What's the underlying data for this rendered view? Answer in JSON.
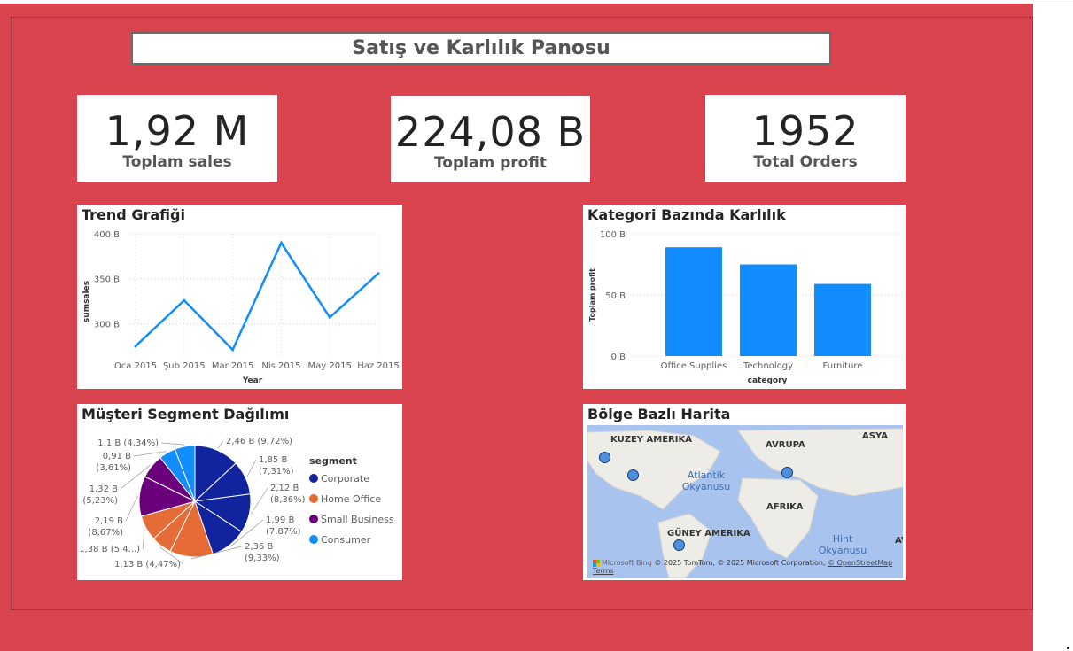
{
  "dashboard": {
    "title": "Satış ve Karlılık Panosu",
    "kpis": [
      {
        "value": "1,92 M",
        "label": "Toplam sales"
      },
      {
        "value": "224,08 B",
        "label": "Toplam profit"
      },
      {
        "value": "1952",
        "label": "Total Orders"
      }
    ]
  },
  "colors": {
    "background": "#d9444f",
    "accent": "#118dff",
    "corporate": "#12239e",
    "home_office": "#e66c37",
    "small_business": "#6b007b",
    "consumer": "#118dff"
  },
  "chart_data": [
    {
      "type": "line",
      "title": "Trend Grafiği",
      "xlabel": "Year",
      "ylabel": "sumsales",
      "x": [
        "Oca 2015",
        "Şub 2015",
        "Mar 2015",
        "Nis 2015",
        "May 2015",
        "Haz 2015"
      ],
      "series": [
        {
          "values": [
            275,
            326,
            271,
            390,
            307,
            356
          ]
        }
      ],
      "ylim": [
        265,
        400
      ],
      "yticks": [
        {
          "value": 300,
          "label": "300 B"
        },
        {
          "value": 350,
          "label": "350 B"
        },
        {
          "value": 400,
          "label": "400 B"
        }
      ],
      "grid": true
    },
    {
      "type": "bar",
      "title": "Kategori Bazında Karlılık",
      "xlabel": "category",
      "ylabel": "Toplam profit",
      "categories": [
        "Office Supplies",
        "Technology",
        "Furniture"
      ],
      "values": [
        89,
        75,
        59
      ],
      "ylim": [
        0,
        100
      ],
      "yticks": [
        {
          "value": 0,
          "label": "0 B"
        },
        {
          "value": 50,
          "label": "50 B"
        },
        {
          "value": 100,
          "label": "100 B"
        }
      ],
      "grid": true
    },
    {
      "type": "pie",
      "title": "Müşteri Segment Dağılımı",
      "legend_title": "segment",
      "legend": [
        {
          "name": "Corporate",
          "color": "#12239e"
        },
        {
          "name": "Home Office",
          "color": "#e66c37"
        },
        {
          "name": "Small Business",
          "color": "#6b007b"
        },
        {
          "name": "Consumer",
          "color": "#118dff"
        }
      ],
      "slices": [
        {
          "segment": "Corporate",
          "value": 2.46,
          "pct": 9.72,
          "label": [
            "2,46 B (9,72%)"
          ]
        },
        {
          "segment": "Corporate",
          "value": 1.85,
          "pct": 7.31,
          "label": [
            "1,85 B",
            "(7,31%)"
          ]
        },
        {
          "segment": "Corporate",
          "value": 2.12,
          "pct": 8.36,
          "label": [
            "2,12 B",
            "(8,36%)"
          ]
        },
        {
          "segment": "Corporate",
          "value": 1.99,
          "pct": 7.87,
          "label": [
            "1,99 B",
            "(7,87%)"
          ]
        },
        {
          "segment": "Home Office",
          "value": 2.36,
          "pct": 9.33,
          "label": [
            "2,36 B",
            "(9,33%)"
          ]
        },
        {
          "segment": "Home Office",
          "value": 1.13,
          "pct": 4.47,
          "label": [
            "1,13 B (4,47%)"
          ]
        },
        {
          "segment": "Home Office",
          "value": 1.38,
          "pct": 5.45,
          "label": [
            "1,38 B (5,4...)"
          ]
        },
        {
          "segment": "Small Business",
          "value": 2.19,
          "pct": 8.67,
          "label": [
            "2,19 B",
            "(8,67%)"
          ]
        },
        {
          "segment": "Small Business",
          "value": 1.32,
          "pct": 5.23,
          "label": [
            "1,32 B",
            "(5,23%)"
          ]
        },
        {
          "segment": "Consumer",
          "value": 0.91,
          "pct": 3.61,
          "label": [
            "0,91 B",
            "(3,61%)"
          ]
        },
        {
          "segment": "Consumer",
          "value": 1.1,
          "pct": 4.34,
          "label": [
            "1,1 B (4,34%)"
          ]
        }
      ]
    }
  ],
  "map": {
    "title": "Bölge Bazlı Harita",
    "regions": [
      "KUZEY AMERIKA",
      "AVRUPA",
      "ASYA",
      "AFRIKA",
      "GÜNEY AMERIKA"
    ],
    "oceans": [
      "Atlantik Okyanusu",
      "Hint Okyanusu"
    ],
    "edge_label": "AV",
    "logo_text": "Microsoft Bing",
    "copyright": "© 2025 TomTom, © 2025 Microsoft Corporation,",
    "osm_link": "© OpenStreetMap",
    "terms_link": "Terms"
  }
}
